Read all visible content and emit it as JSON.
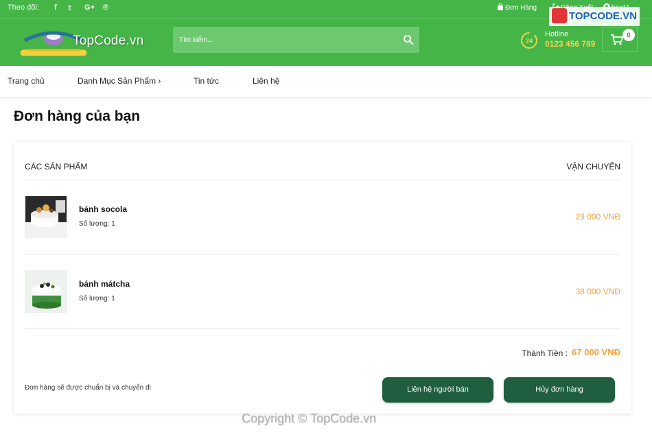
{
  "topbar": {
    "follow_label": "Theo dõi:",
    "social_icons": [
      "facebook-icon",
      "twitter-icon",
      "google-plus-icon",
      "pinterest-icon"
    ],
    "social_glyphs": [
      "f",
      "𝕥",
      "G+",
      "℗"
    ],
    "orders_label": "Đơn Hàng",
    "logout_label": "Đăng Xuất",
    "username": "bac11"
  },
  "header": {
    "logo_watermark": "TopCode.vn",
    "search_placeholder": "Tìm kiếm...",
    "hotline_label": "Hotline",
    "hotline_number": "0123 456 789",
    "cart_count": "0",
    "hotline_badge": "24"
  },
  "watermark": {
    "brand": "TOPCODE.VN",
    "copyright": "Copyright © TopCode.vn"
  },
  "nav": {
    "items": [
      "Trang chủ",
      "Danh Mục Sản Phẩm ›",
      "Tin tức",
      "Liên hệ"
    ]
  },
  "page": {
    "title": "Đơn hàng của bạn"
  },
  "order": {
    "col_products": "CÁC SẢN PHẨM",
    "col_shipping": "VẬN CHUYỂN",
    "items": [
      {
        "name": "bánh socola",
        "qty_label": "Số lượng: 1",
        "price": "29 000 VNĐ"
      },
      {
        "name": "bánh mátcha",
        "qty_label": "Số lượng: 1",
        "price": "38 000 VNĐ"
      }
    ],
    "total_label": "Thành Tiền :",
    "total_value": "67 000 VNĐ",
    "status": "Đơn hàng sẽ được chuẩn bị và chuyển đi",
    "contact_button": "Liên hệ người bán",
    "cancel_button": "Hủy đơn hàng"
  },
  "colors": {
    "brand_green": "#45b548",
    "button_dark_green": "#1f5e3f",
    "price_orange": "#f0a441",
    "hotline_yellow": "#f6d24a"
  }
}
